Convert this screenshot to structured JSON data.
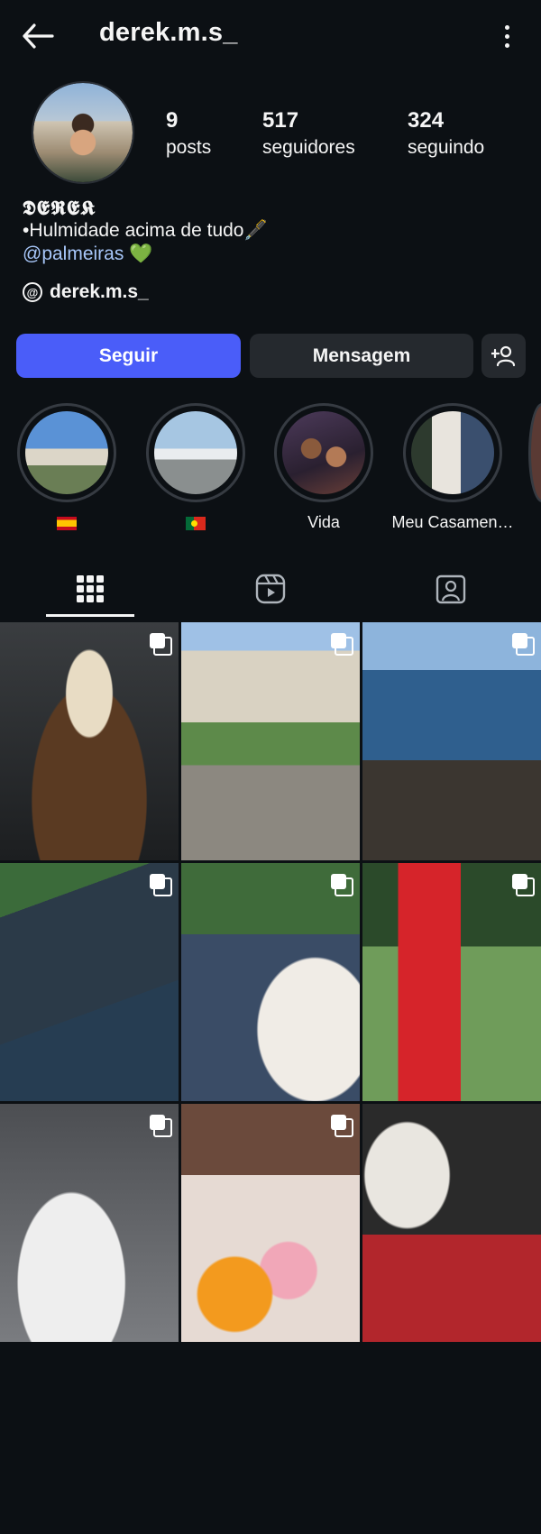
{
  "header": {
    "username": "derek.m.s_"
  },
  "stats": [
    {
      "value": "9",
      "label": "posts"
    },
    {
      "value": "517",
      "label": "seguidores"
    },
    {
      "value": "324",
      "label": "seguindo"
    }
  ],
  "bio": {
    "display_name": "𝕯𝕰𝕽𝕰𝕶",
    "line1": "•Hulmidade acima de tudo🖋️",
    "link": "@palmeiras",
    "link_emoji": "💚",
    "threads_handle": "derek.m.s_"
  },
  "actions": {
    "follow_label": "Seguir",
    "message_label": "Mensagem"
  },
  "highlights": [
    {
      "label": "🇪🇸",
      "icon": "flag-spain"
    },
    {
      "label": "🇵🇹",
      "icon": "flag-portugal"
    },
    {
      "label": "Vida"
    },
    {
      "label": "Meu Casamen…"
    }
  ],
  "tabs": [
    {
      "icon": "grid-icon",
      "active": true
    },
    {
      "icon": "reels-icon",
      "active": false
    },
    {
      "icon": "tagged-icon",
      "active": false
    }
  ],
  "colors": {
    "background": "#0c1014",
    "follow_button": "#4a5df9",
    "secondary_button": "#25292e",
    "link": "#a8c7fa"
  },
  "posts": [
    {
      "multi": true
    },
    {
      "multi": true
    },
    {
      "multi": true
    },
    {
      "multi": true
    },
    {
      "multi": true
    },
    {
      "multi": true
    },
    {
      "multi": true
    },
    {
      "multi": true
    },
    {
      "multi": false
    }
  ]
}
